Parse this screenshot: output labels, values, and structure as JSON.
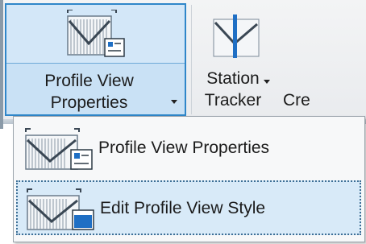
{
  "ribbon": {
    "profile_view_properties": {
      "label_line1": "Profile View",
      "label_line2": "Properties",
      "icon": "profile-view-properties-icon"
    },
    "station_tracker": {
      "label_line1": "Station",
      "label_line2": "Tracker",
      "icon": "station-tracker-icon"
    },
    "cut_label": "Cre"
  },
  "menu": {
    "items": [
      {
        "label": "Profile View Properties",
        "icon": "profile-view-properties-icon",
        "state": "normal"
      },
      {
        "label": "Edit Profile View Style",
        "icon": "edit-profile-view-style-icon",
        "state": "hover"
      }
    ]
  },
  "colors": {
    "selected_border": "#2f86c9",
    "selected_fill": "#cfe5f7",
    "accent_blue": "#1f6fc4",
    "hover_fill": "#d8eaf8"
  }
}
